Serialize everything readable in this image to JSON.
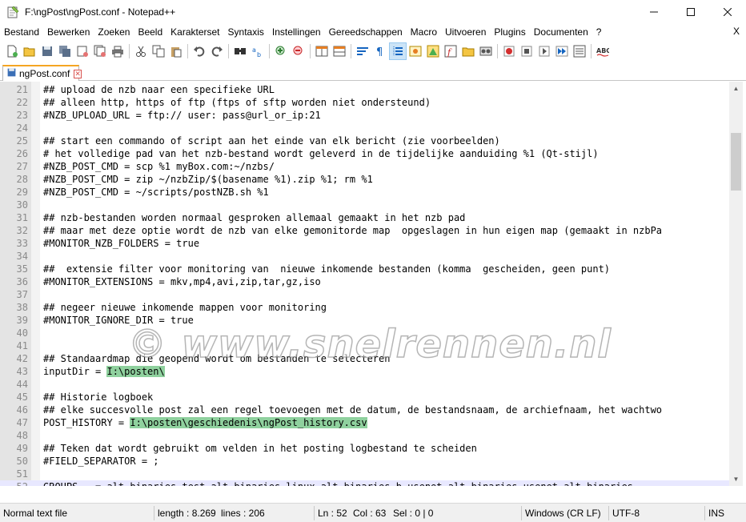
{
  "window": {
    "title": "F:\\ngPost\\ngPost.conf - Notepad++",
    "app_icon": "notepad-plus-plus-icon"
  },
  "menu": {
    "items": [
      "Bestand",
      "Bewerken",
      "Zoeken",
      "Beeld",
      "Karakterset",
      "Syntaxis",
      "Instellingen",
      "Gereedschappen",
      "Macro",
      "Uitvoeren",
      "Plugins",
      "Documenten",
      "?"
    ],
    "close_label": "X"
  },
  "toolbar": {
    "icons": [
      "new-file-icon",
      "open-file-icon",
      "save-icon",
      "save-all-icon",
      "close-icon",
      "close-all-icon",
      "print-icon",
      "cut-icon",
      "copy-icon",
      "paste-icon",
      "undo-icon",
      "redo-icon",
      "find-icon",
      "replace-icon",
      "zoom-in-icon",
      "zoom-out-icon",
      "sync-vertical-icon",
      "sync-horizontal-icon",
      "word-wrap-icon",
      "show-all-chars-icon",
      "indent-guide-icon",
      "udl-icon",
      "doc-map-icon",
      "function-list-icon",
      "folder-workspace-icon",
      "monitoring-icon",
      "record-macro-icon",
      "stop-macro-icon",
      "play-macro-icon",
      "run-macro-multiple-icon",
      "save-macro-icon",
      "spell-check-icon"
    ]
  },
  "tab": {
    "label": "ngPost.conf"
  },
  "editor": {
    "lines": [
      {
        "n": "21",
        "text": "## upload de nzb naar een specifieke URL"
      },
      {
        "n": "22",
        "text": "## alleen http, https of ftp (ftps of sftp worden niet ondersteund)"
      },
      {
        "n": "23",
        "text": "#NZB_UPLOAD_URL = ftp:// user: pass@url_or_ip:21"
      },
      {
        "n": "24",
        "text": ""
      },
      {
        "n": "25",
        "text": "## start een commando of script aan het einde van elk bericht (zie voorbeelden)"
      },
      {
        "n": "26",
        "text": "# het volledige pad van het nzb-bestand wordt geleverd in de tijdelijke aanduiding %1 (Qt-stijl)"
      },
      {
        "n": "27",
        "text": "#NZB_POST_CMD = scp %1 myBox.com:~/nzbs/"
      },
      {
        "n": "28",
        "text": "#NZB_POST_CMD = zip ~/nzbZip/$(basename %1).zip %1; rm %1"
      },
      {
        "n": "29",
        "text": "#NZB_POST_CMD = ~/scripts/postNZB.sh %1"
      },
      {
        "n": "30",
        "text": ""
      },
      {
        "n": "31",
        "text": "## nzb-bestanden worden normaal gesproken allemaal gemaakt in het nzb pad"
      },
      {
        "n": "32",
        "text": "## maar met deze optie wordt de nzb van elke gemonitorde map  opgeslagen in hun eigen map (gemaakt in nzbPa"
      },
      {
        "n": "33",
        "text": "#MONITOR_NZB_FOLDERS = true"
      },
      {
        "n": "34",
        "text": ""
      },
      {
        "n": "35",
        "text": "##  extensie filter voor monitoring van  nieuwe inkomende bestanden (komma  gescheiden, geen punt)"
      },
      {
        "n": "36",
        "text": "#MONITOR_EXTENSIONS = mkv,mp4,avi,zip,tar,gz,iso"
      },
      {
        "n": "37",
        "text": ""
      },
      {
        "n": "38",
        "text": "## negeer nieuwe inkomende mappen voor monitoring"
      },
      {
        "n": "39",
        "text": "#MONITOR_IGNORE_DIR = true"
      },
      {
        "n": "40",
        "text": ""
      },
      {
        "n": "41",
        "text": ""
      },
      {
        "n": "42",
        "text": "## Standaardmap die geopend wordt om bestanden te selecteren"
      },
      {
        "n": "43",
        "text": "inputDir = ",
        "highlight": "I:\\posten\\"
      },
      {
        "n": "44",
        "text": ""
      },
      {
        "n": "45",
        "text": "## Historie logboek"
      },
      {
        "n": "46",
        "text": "## elke succesvolle post zal een regel toevoegen met de datum, de bestandsnaam, de archiefnaam, het wachtwo"
      },
      {
        "n": "47",
        "text": "POST_HISTORY = ",
        "highlight": "I:\\posten\\geschiedenis\\ngPost_history.csv"
      },
      {
        "n": "48",
        "text": ""
      },
      {
        "n": "49",
        "text": "## Teken dat wordt gebruikt om velden in het posting logbestand te scheiden"
      },
      {
        "n": "50",
        "text": "#FIELD_SEPARATOR = ;"
      },
      {
        "n": "51",
        "text": ""
      },
      {
        "n": "52",
        "text": "GROUPS   = alt.binaries.test,alt.binaries.linux,alt.binaries.b.usenet,alt.binaries.usenet,alt.binaries"
      }
    ]
  },
  "watermark": "© www.snelrennen.nl",
  "status": {
    "file_type": "Normal text file",
    "length": "length : 8.269",
    "lines": "lines : 206",
    "ln": "Ln : 52",
    "col": "Col : 63",
    "sel": "Sel : 0 | 0",
    "eol": "Windows (CR LF)",
    "encoding": "UTF-8",
    "mode": "INS"
  },
  "colors": {
    "highlight": "#8fd19e",
    "tab_accent": "#f5a623",
    "gutter": "#e4e4e4"
  }
}
